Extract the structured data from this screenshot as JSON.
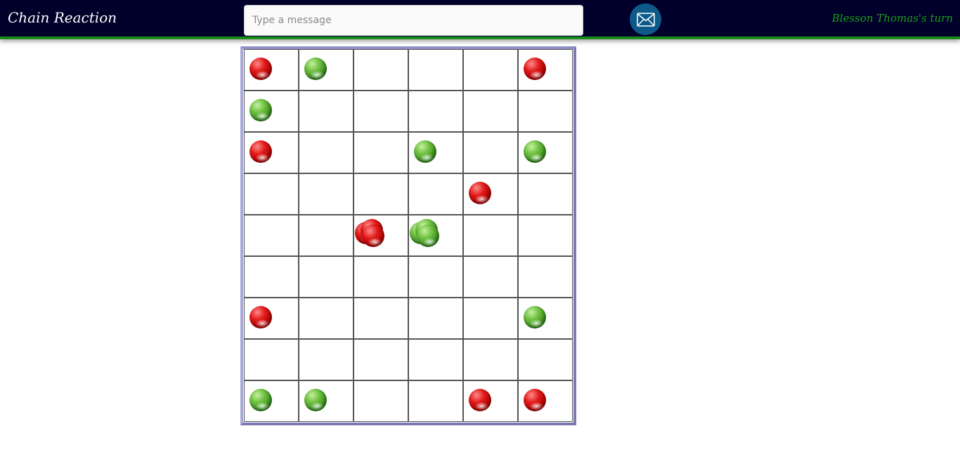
{
  "header": {
    "title": "Chain Reaction",
    "message_placeholder": "Type a message",
    "send_icon": "envelope-icon",
    "turn_text": "Blesson Thomas's turn"
  },
  "colors": {
    "header_bg": "#00002a",
    "header_accent": "#1a8a1a",
    "turn_text": "#18a018",
    "send_button": "#0d5a8a",
    "board_border": "#7a7ab0",
    "red_player": "#d01010",
    "green_player": "#4a9a2a"
  },
  "board": {
    "rows": 9,
    "cols": 6,
    "cells": [
      [
        {
          "player": "red",
          "count": 1
        },
        {
          "player": "green",
          "count": 1
        },
        null,
        null,
        null,
        {
          "player": "red",
          "count": 1
        }
      ],
      [
        {
          "player": "green",
          "count": 1
        },
        null,
        null,
        null,
        null,
        null
      ],
      [
        {
          "player": "red",
          "count": 1
        },
        null,
        null,
        {
          "player": "green",
          "count": 1
        },
        null,
        {
          "player": "green",
          "count": 1
        }
      ],
      [
        null,
        null,
        null,
        null,
        {
          "player": "red",
          "count": 1
        },
        null
      ],
      [
        null,
        null,
        {
          "player": "red",
          "count": 3
        },
        {
          "player": "green",
          "count": 3
        },
        null,
        null
      ],
      [
        null,
        null,
        null,
        null,
        null,
        null
      ],
      [
        {
          "player": "red",
          "count": 1
        },
        null,
        null,
        null,
        null,
        {
          "player": "green",
          "count": 1
        }
      ],
      [
        null,
        null,
        null,
        null,
        null,
        null
      ],
      [
        {
          "player": "green",
          "count": 1
        },
        {
          "player": "green",
          "count": 1
        },
        null,
        null,
        {
          "player": "red",
          "count": 1
        },
        {
          "player": "red",
          "count": 1
        }
      ]
    ]
  }
}
